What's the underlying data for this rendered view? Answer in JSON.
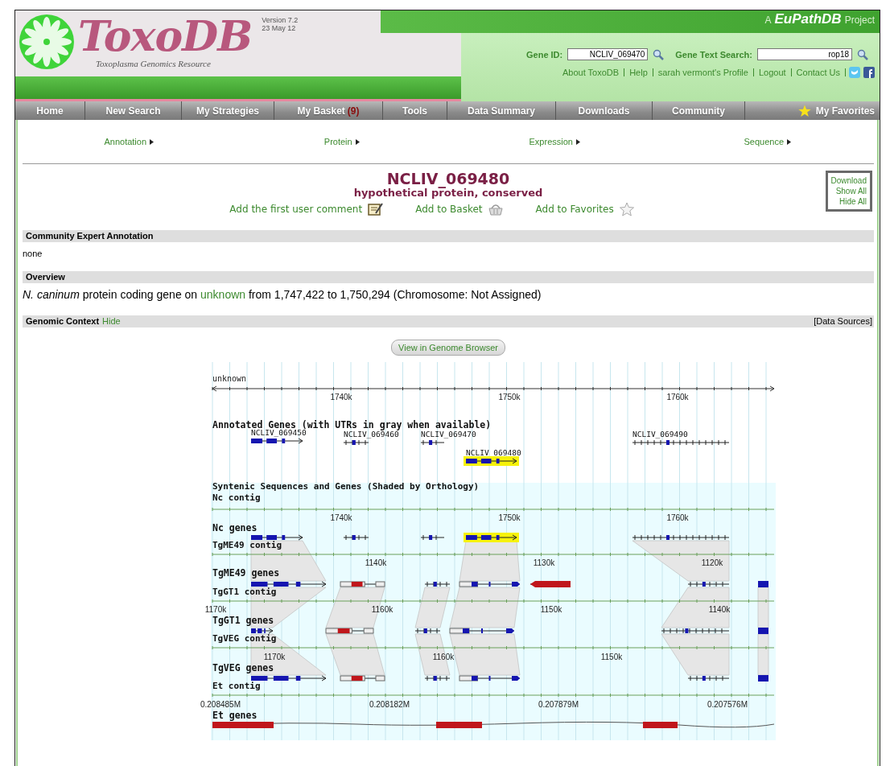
{
  "header": {
    "logo_title": "ToxoDB",
    "subtitle": "Toxoplasma Genomics Resource",
    "version": "Version 7.2",
    "date": "23 May 12",
    "project_prefix": "A",
    "project_name": "EuPathDB",
    "project_suffix": "Project"
  },
  "search": [
    {
      "label": "Gene ID:",
      "value": "NCLIV_069470"
    },
    {
      "label": "Gene Text Search:",
      "value": "rop18"
    }
  ],
  "top_links": [
    "About ToxoDB",
    "Help",
    "sarah vermont's Profile",
    "Logout",
    "Contact Us"
  ],
  "nav": [
    {
      "label": "Home"
    },
    {
      "label": "New Search"
    },
    {
      "label": "My Strategies"
    },
    {
      "label": "My Basket",
      "count": "(9)"
    },
    {
      "label": "Tools"
    },
    {
      "label": "Data Summary"
    },
    {
      "label": "Downloads"
    },
    {
      "label": "Community"
    }
  ],
  "favorites": "My Favorites",
  "subnav": [
    "Annotation",
    "Protein",
    "Expression",
    "Sequence"
  ],
  "gene": {
    "id": "NCLIV_069480",
    "product": "hypothetical protein, conserved",
    "actions": [
      {
        "label": "Add the first user comment",
        "kind": "comment"
      },
      {
        "label": "Add to Basket",
        "kind": "basket"
      },
      {
        "label": "Add to Favorites",
        "kind": "favorite"
      }
    ]
  },
  "page_tools": [
    "Download",
    "Show All",
    "Hide All"
  ],
  "community_annotation": {
    "title": "Community Expert Annotation",
    "text": "none"
  },
  "overview": {
    "title": "Overview",
    "prefix": "*N. caninum* protein coding gene on",
    "link": "unknown",
    "suffix": "from 1,747,422 to 1,750,294 (Chromosome: Not Assigned)"
  },
  "genomic_context": {
    "title": "Genomic Context",
    "toggle": "Hide",
    "sources": "[Data Sources]",
    "button": "View in Genome Browser",
    "diagram": {
      "sequence": "unknown",
      "ticks": [
        "1740k",
        "1750k",
        "1760k"
      ],
      "annotated_title": "Annotated Genes (with UTRs in gray when available)",
      "genes": [
        {
          "label": "NCLIV_069450",
          "selected": false
        },
        {
          "label": "NCLIV_069460",
          "selected": false
        },
        {
          "label": "NCLIV_069470",
          "selected": false
        },
        {
          "label": "NCLIV_069480",
          "selected": true
        },
        {
          "label": "NCLIV_069490",
          "selected": false
        }
      ],
      "syntenic_title": "Syntenic Sequences and Genes (Shaded by Orthology)",
      "tracks": [
        {
          "contig": "Nc contig",
          "ticks": [
            "1740k",
            "1750k",
            "1760k"
          ],
          "genes": "Nc genes"
        },
        {
          "contig": "TgME49 contig",
          "ticks": [
            "1140k",
            "1130k",
            "1120k"
          ],
          "genes": "TgME49 genes"
        },
        {
          "contig": "TgGT1 contig",
          "ticks": [
            "1170k",
            "1160k",
            "1150k",
            "1140k"
          ],
          "genes": "TgGT1 genes"
        },
        {
          "contig": "TgVEG contig",
          "ticks": [
            "1170k",
            "1160k",
            "1150k"
          ],
          "genes": "TgVEG genes"
        },
        {
          "contig": "Et contig",
          "ticks": [
            "0.208485M",
            "0.208182M",
            "0.207879M",
            "0.207576M"
          ],
          "genes": "Et genes"
        }
      ]
    }
  }
}
